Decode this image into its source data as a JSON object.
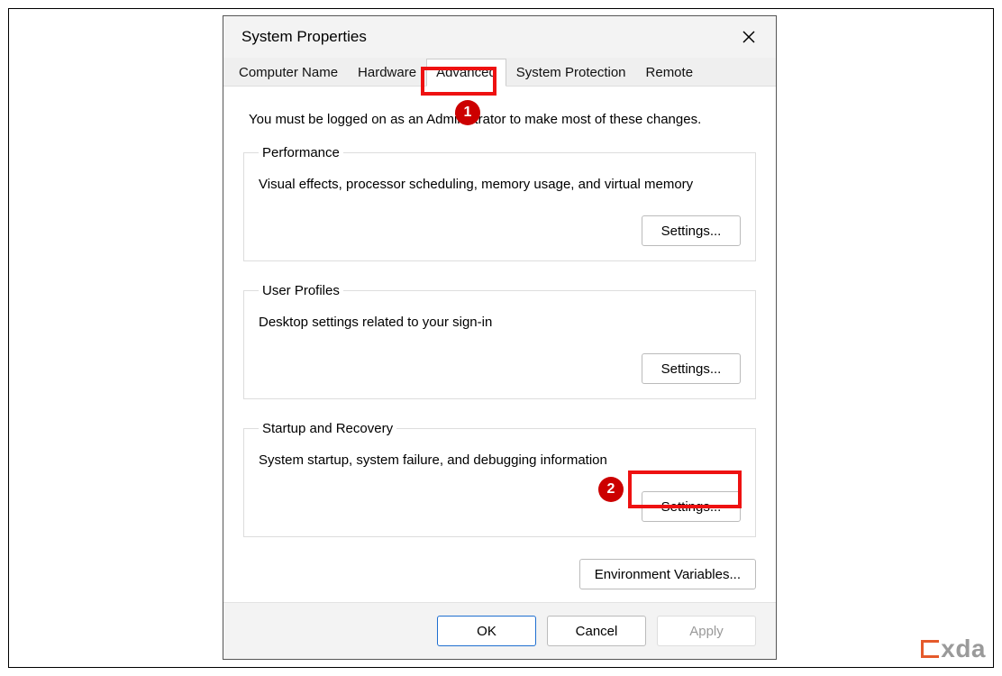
{
  "window": {
    "title": "System Properties"
  },
  "tabs": [
    {
      "label": "Computer Name"
    },
    {
      "label": "Hardware"
    },
    {
      "label": "Advanced"
    },
    {
      "label": "System Protection"
    },
    {
      "label": "Remote"
    }
  ],
  "adminNote": "You must be logged on as an Administrator to make most of these changes.",
  "groups": {
    "performance": {
      "legend": "Performance",
      "desc": "Visual effects, processor scheduling, memory usage, and virtual memory",
      "button": "Settings..."
    },
    "userProfiles": {
      "legend": "User Profiles",
      "desc": "Desktop settings related to your sign-in",
      "button": "Settings..."
    },
    "startupRecovery": {
      "legend": "Startup and Recovery",
      "desc": "System startup, system failure, and debugging information",
      "button": "Settings..."
    }
  },
  "envButton": "Environment Variables...",
  "footer": {
    "ok": "OK",
    "cancel": "Cancel",
    "apply": "Apply"
  },
  "annotations": {
    "circle1": "1",
    "circle2": "2"
  },
  "watermark": "xda"
}
